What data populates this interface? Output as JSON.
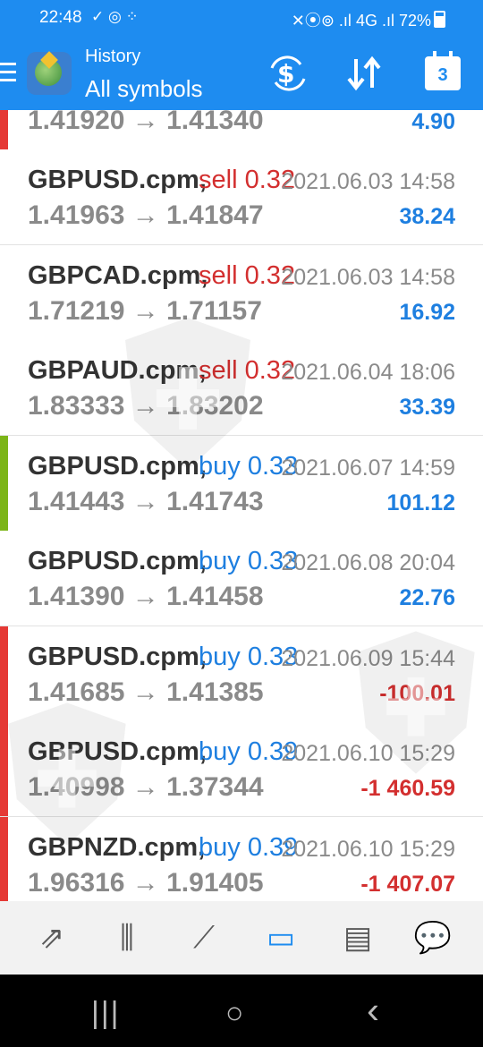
{
  "status_bar": {
    "time": "22:48",
    "left_icons": "✓ ◎ ⁘",
    "right_text": "4G .ıl 72%",
    "signal_icons": "✕⦿⊚ .ıl"
  },
  "header": {
    "title": "History",
    "subtitle": "All symbols",
    "calendar_number": "3"
  },
  "colors": {
    "accent": "#1e8cf0",
    "sell": "#d32f2f",
    "buy": "#1e7fe0",
    "profit_pos": "#1e7fe0",
    "profit_neg": "#d32f2f",
    "indicator_green": "#7cb518",
    "indicator_red": "#e53935"
  },
  "partial_row": {
    "prices": "1.41920 → 1.41340",
    "profit": "4.90"
  },
  "trades": [
    {
      "symbol": "GBPUSD.cpm,",
      "type": "sell 0.32",
      "side": "sell",
      "date": "2021.06.03 14:58",
      "prices": "1.41963 → 1.41847",
      "profit": "38.24",
      "positive": true,
      "indicator": "none"
    },
    {
      "symbol": "GBPCAD.cpm,",
      "type": "sell 0.32",
      "side": "sell",
      "date": "2021.06.03 14:58",
      "prices": "1.71219 → 1.71157",
      "profit": "16.92",
      "positive": true,
      "indicator": "none"
    },
    {
      "symbol": "GBPAUD.cpm,",
      "type": "sell 0.32",
      "side": "sell",
      "date": "2021.06.04 18:06",
      "prices": "1.83333 → 1.83202",
      "profit": "33.39",
      "positive": true,
      "indicator": "none"
    },
    {
      "symbol": "GBPUSD.cpm,",
      "type": "buy 0.33",
      "side": "buy",
      "date": "2021.06.07 14:59",
      "prices": "1.41443 → 1.41743",
      "profit": "101.12",
      "positive": true,
      "indicator": "green"
    },
    {
      "symbol": "GBPUSD.cpm,",
      "type": "buy 0.33",
      "side": "buy",
      "date": "2021.06.08 20:04",
      "prices": "1.41390 → 1.41458",
      "profit": "22.76",
      "positive": true,
      "indicator": "none"
    },
    {
      "symbol": "GBPUSD.cpm,",
      "type": "buy 0.33",
      "side": "buy",
      "date": "2021.06.09 15:44",
      "prices": "1.41685 → 1.41385",
      "profit": "-100.01",
      "positive": false,
      "indicator": "red"
    },
    {
      "symbol": "GBPUSD.cpm,",
      "type": "buy 0.39",
      "side": "buy",
      "date": "2021.06.10 15:29",
      "prices": "1.40998 → 1.37344",
      "profit": "-1 460.59",
      "positive": false,
      "indicator": "red"
    },
    {
      "symbol": "GBPNZD.cpm,",
      "type": "buy 0.39",
      "side": "buy",
      "date": "2021.06.10 15:29",
      "prices": "1.96316 → 1.91405",
      "profit": "-1 407.07",
      "positive": false,
      "indicator": "red"
    }
  ],
  "bottom_nav": [
    {
      "name": "quotes-icon",
      "glyph": "⇗"
    },
    {
      "name": "chart-icon",
      "glyph": "⫼"
    },
    {
      "name": "trade-icon",
      "glyph": "⟋"
    },
    {
      "name": "history-icon",
      "glyph": "▭",
      "active": true
    },
    {
      "name": "news-icon",
      "glyph": "▤"
    },
    {
      "name": "chat-icon",
      "glyph": "💬"
    }
  ],
  "system_nav": {
    "recents": "|||",
    "home": "○",
    "back": "‹"
  }
}
